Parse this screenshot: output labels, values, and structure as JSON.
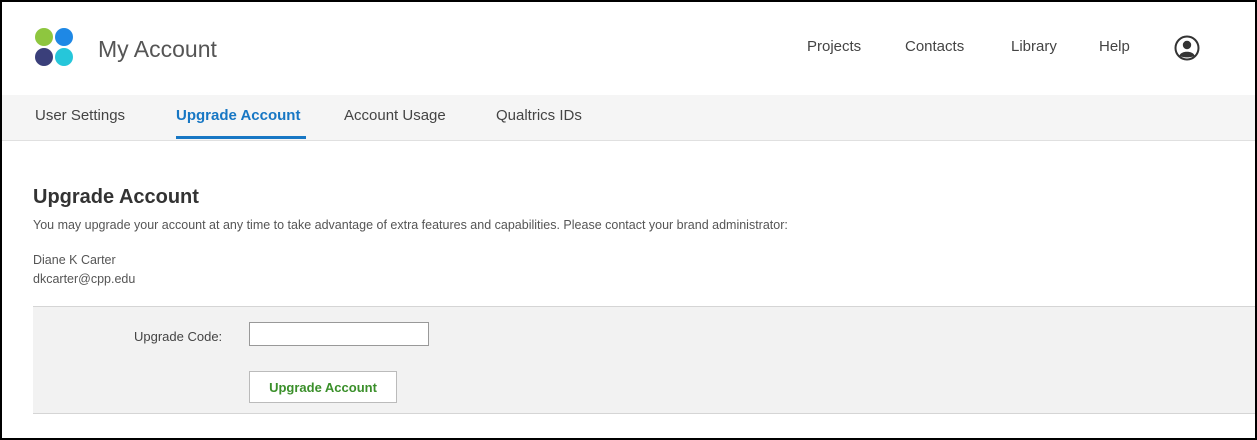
{
  "header": {
    "app_title": "My Account",
    "nav": [
      {
        "label": "Projects"
      },
      {
        "label": "Contacts"
      },
      {
        "label": "Library"
      },
      {
        "label": "Help"
      }
    ],
    "user_icon": "user-avatar-icon",
    "logo_colors": [
      "#8ec63f",
      "#1e88e5",
      "#3a3f7a",
      "#26c6da"
    ]
  },
  "tabs": [
    {
      "label": "User Settings",
      "active": false
    },
    {
      "label": "Upgrade Account",
      "active": true
    },
    {
      "label": "Account Usage",
      "active": false
    },
    {
      "label": "Qualtrics IDs",
      "active": false
    }
  ],
  "main": {
    "title": "Upgrade Account",
    "description": "You may upgrade your account at any time to take advantage of extra features and capabilities. Please contact your brand administrator:",
    "admin_name": "Diane K Carter",
    "admin_email": "dkcarter@cpp.edu",
    "form": {
      "code_label": "Upgrade Code:",
      "code_value": "",
      "button_label": "Upgrade Account"
    }
  },
  "colors": {
    "accent": "#1777c4",
    "button_text": "#3a8f2a"
  }
}
